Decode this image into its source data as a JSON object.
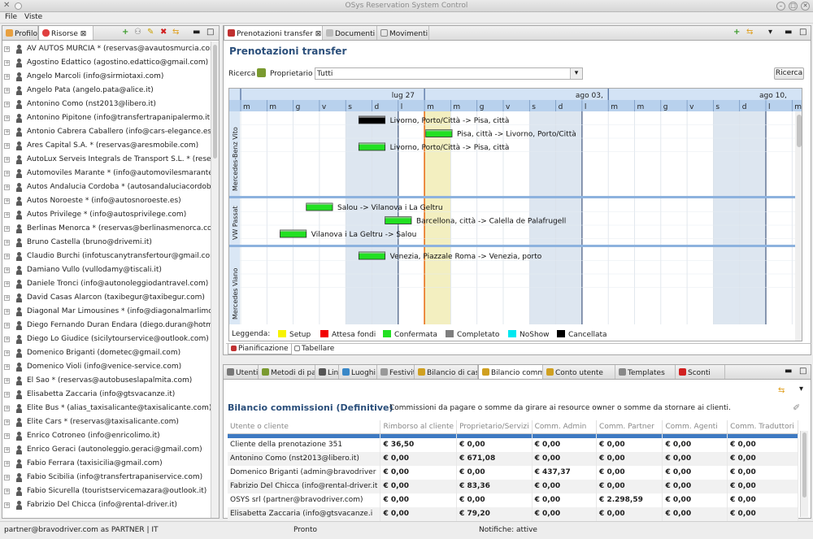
{
  "window": {
    "title": "OSys Reservation System Control"
  },
  "menu": [
    "File",
    "Viste"
  ],
  "left_tabs": [
    {
      "label": "Profilo"
    },
    {
      "label": "Risorse"
    }
  ],
  "resources": [
    "AV AUTOS MURCIA * (reservas@avautosmurcia.com)",
    "Agostino Edattico (agostino.edattico@gmail.com)",
    "Angelo Marcoli (info@sirmiotaxi.com)",
    "Angelo Pata (angelo.pata@alice.it)",
    "Antonino Como (nst2013@libero.it)",
    "Antonino Pipitone (info@transfertrapanipalermo.it)",
    "Antonio Cabrera Caballero (info@cars-elegance.es)",
    "Ares Capital S.A. * (reservas@aresmobile.com)",
    "AutoLux Serveis Integrals de Transport S.L. * (reserva",
    "Automoviles Marante * (info@automovilesmarante.co",
    "Autos Andalucia Cordoba * (autosandaluciacordoba.3",
    "Autos Noroeste * (info@autosnoroeste.es)",
    "Autos Privilege * (info@autosprivilege.com)",
    "Berlinas Menorca * (reservas@berlinasmenorca.com",
    "Bruno Castella (bruno@drivemi.it)",
    "Claudio Burchi (infotuscanytransfertour@gmail.com)",
    "Damiano Vullo (vullodamy@tiscali.it)",
    "Daniele Tronci (info@autonoleggiodantravel.com)",
    "David Casas Alarcon (taxibegur@taxibegur.com)",
    "Diagonal Mar Limousines * (info@diagonalmarlimous",
    "Diego Fernando Duran Endara (diego.duran@hotmail",
    "Diego Lo Giudice (sicilytourservice@outlook.com)",
    "Domenico Briganti (dometec@gmail.com)",
    "Domenico Violi (info@venice-service.com)",
    "El Sao * (reservas@autobuseslapalmita.com)",
    "Elisabetta  Zaccaria (info@gtsvacanze.it)",
    "Elite Bus * (alias_taxisalicante@taxisalicante.com)",
    "Elite Cars * (reservas@taxisalicante.com)",
    "Enrico Cotroneo (info@enricolimo.it)",
    "Enrico Geraci (autonoleggio.geraci@gmail.com)",
    "Fabio Ferrara (taxisicilia@gmail.com)",
    "Fabio Scibilia (info@transfertrapaniservice.com)",
    "Fabio Sicurella (touristservicemazara@outlook.it)",
    "Fabrizio Del Chicca (info@rental-driver.it)"
  ],
  "editor_tabs": [
    {
      "label": "Prenotazioni transfer"
    },
    {
      "label": "Documenti"
    },
    {
      "label": "Movimenti"
    }
  ],
  "prenotazioni": {
    "heading": "Prenotazioni transfer",
    "search_label": "Ricerca",
    "owner_label": "Proprietario",
    "owner_value": "Tutti",
    "search_button": "Ricerca",
    "weeks": [
      "lug 27",
      "ago 03,",
      "ago 10,"
    ],
    "days": [
      "m",
      "m",
      "g",
      "v",
      "s",
      "d",
      "l",
      "m",
      "m",
      "g",
      "v",
      "s",
      "d",
      "l",
      "m",
      "m",
      "g",
      "v",
      "s",
      "d",
      "l",
      "m"
    ],
    "vehicles": [
      "Mercedes-Benz Vito",
      "VW Passat",
      "Mercedes Viano"
    ],
    "bookings": [
      {
        "label": "Livorno, Porto/Città -> Pisa, città",
        "status": "Cancellata",
        "vehicle": 0,
        "lane": 0
      },
      {
        "label": "Pisa, città -> Livorno, Porto/Città",
        "status": "Confermata",
        "vehicle": 0,
        "lane": 1
      },
      {
        "label": "Livorno, Porto/Città -> Pisa, città",
        "status": "Confermata",
        "vehicle": 0,
        "lane": 2
      },
      {
        "label": "Salou -> Vilanova i La Geltru",
        "status": "Confermata",
        "vehicle": 1,
        "lane": 0
      },
      {
        "label": "Barcellona, città -> Calella de Palafrugell",
        "status": "Confermata",
        "vehicle": 1,
        "lane": 1
      },
      {
        "label": "Vilanova i La Geltru -> Salou",
        "status": "Confermata",
        "vehicle": 1,
        "lane": 2
      },
      {
        "label": "Venezia, Piazzale Roma -> Venezia, porto",
        "status": "Confermata",
        "vehicle": 2,
        "lane": 0
      }
    ],
    "legend_title": "Leggenda:",
    "legend": [
      {
        "label": "Setup",
        "color": "#f7f300"
      },
      {
        "label": "Attesa fondi",
        "color": "#f20000"
      },
      {
        "label": "Confermata",
        "color": "#22e022"
      },
      {
        "label": "Completato",
        "color": "#7f7f7f"
      },
      {
        "label": "NoShow",
        "color": "#00e8f0"
      },
      {
        "label": "Cancellata",
        "color": "#000000"
      }
    ],
    "subtabs": [
      "Pianificazione",
      "Tabellare"
    ]
  },
  "bottom_tabs": [
    {
      "label": "Utenti"
    },
    {
      "label": "Metodi di paga..."
    },
    {
      "label": "Lingue"
    },
    {
      "label": "Luoghi"
    },
    {
      "label": "Festività"
    },
    {
      "label": "Bilancio di cass..."
    },
    {
      "label": "Bilancio commi..."
    },
    {
      "label": "Conto utente"
    },
    {
      "label": "Templates"
    },
    {
      "label": "Sconti"
    }
  ],
  "bilancio": {
    "heading": "Bilancio commissioni (Definitive)",
    "description": "Commissioni da pagare o somme da girare ai resource owner o somme da stornare ai clienti.",
    "columns": [
      "Utente o cliente",
      "Rimborso al cliente",
      "Proprietario/Servizi",
      "Comm. Admin",
      "Comm. Partner",
      "Comm. Agenti",
      "Comm. Traduttori"
    ],
    "rows": [
      [
        "Cliente della prenotazione 351",
        "€ 36,50",
        "€ 0,00",
        "€ 0,00",
        "€ 0,00",
        "€ 0,00",
        "€ 0,00"
      ],
      [
        "Antonino Como (nst2013@libero.it)",
        "€ 0,00",
        "€ 671,08",
        "€ 0,00",
        "€ 0,00",
        "€ 0,00",
        "€ 0,00"
      ],
      [
        "Domenico Briganti (admin@bravodriver",
        "€ 0,00",
        "€ 0,00",
        "€ 437,37",
        "€ 0,00",
        "€ 0,00",
        "€ 0,00"
      ],
      [
        "Fabrizio Del Chicca (info@rental-driver.it",
        "€ 0,00",
        "€ 83,36",
        "€ 0,00",
        "€ 0,00",
        "€ 0,00",
        "€ 0,00"
      ],
      [
        "OSYS srl (partner@bravodriver.com)",
        "€ 0,00",
        "€ 0,00",
        "€ 0,00",
        "€ 2.298,59",
        "€ 0,00",
        "€ 0,00"
      ],
      [
        "Elisabetta  Zaccaria (info@gtsvacanze.i",
        "€ 0,00",
        "€ 79,20",
        "€ 0,00",
        "€ 0,00",
        "€ 0,00",
        "€ 0,00"
      ]
    ]
  },
  "status": {
    "user": "partner@bravodriver.com as PARTNER | IT",
    "state": "Pronto",
    "notifications": "Notifiche: attive"
  }
}
